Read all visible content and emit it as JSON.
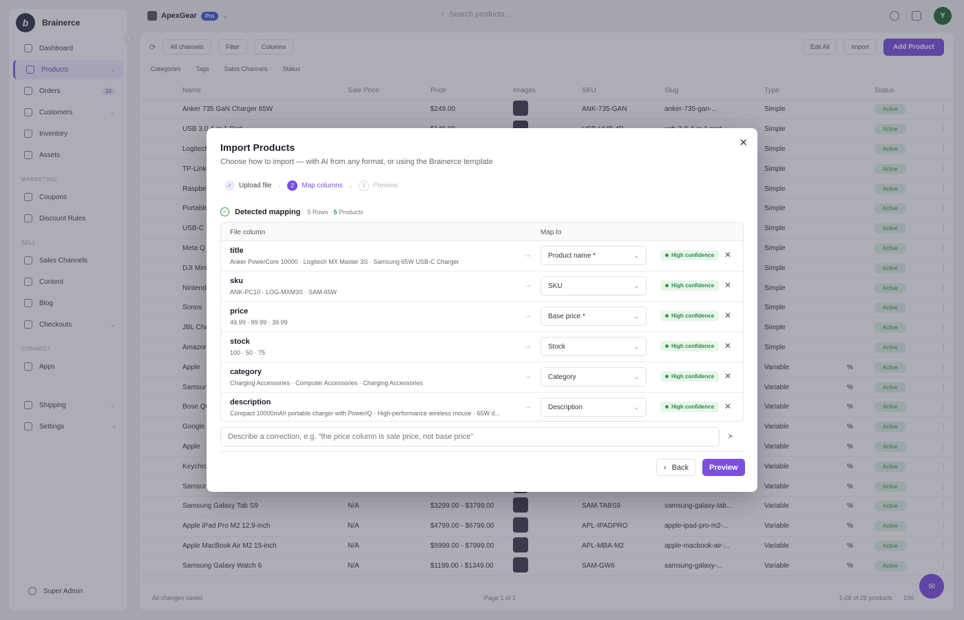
{
  "app": {
    "brand_name": "Brainerce",
    "brand_initial": "b"
  },
  "sidebar": {
    "items": [
      {
        "label": "Dashboard",
        "chevron": "",
        "badge": ""
      },
      {
        "label": "Products",
        "chevron": "⌄",
        "badge": ""
      },
      {
        "label": "Orders",
        "chevron": "",
        "badge": "10"
      },
      {
        "label": "Customers",
        "chevron": "⌄",
        "badge": ""
      },
      {
        "label": "Inventory",
        "chevron": "",
        "badge": ""
      },
      {
        "label": "Assets",
        "chevron": "",
        "badge": ""
      }
    ],
    "section_marketing": "MARKETING",
    "marketing_items": [
      {
        "label": "Coupons"
      },
      {
        "label": "Discount Rules"
      }
    ],
    "section_sell": "SELL",
    "sell_items": [
      {
        "label": "Sales Channels",
        "chevron": ""
      },
      {
        "label": "Content",
        "chevron": ""
      },
      {
        "label": "Blog",
        "chevron": ""
      },
      {
        "label": "Checkouts",
        "chevron": "⌄"
      }
    ],
    "section_connect": "CONNECT",
    "connect_items": [
      {
        "label": "Apps"
      }
    ],
    "bottom_items": [
      {
        "label": "Shipping",
        "chevron": "⌄"
      },
      {
        "label": "Settings",
        "chevron": "›"
      }
    ],
    "footer_label": "Super Admin"
  },
  "topbar": {
    "store_name": "ApexGear",
    "store_badge": "Pro",
    "search_placeholder": "Search products..."
  },
  "toolbar": {
    "all_channels": "All channels",
    "filter": "Filter",
    "columns": "Columns",
    "edit_all": "Edit All",
    "import": "Import",
    "add_product": "Add Product"
  },
  "filters": [
    "Categories",
    "Tags",
    "Sales Channels",
    "Status"
  ],
  "table": {
    "headers": [
      "Name",
      "Sale Price",
      "Price",
      "Images",
      "SKU",
      "Slug",
      "Type",
      "",
      "Status"
    ],
    "rows": [
      {
        "name": "Anker 735 GaN Charger 65W",
        "sale": "",
        "price": "$249.00",
        "sku": "ANK-735-GAN",
        "slug": "anker-735-gan-...",
        "type": "Simple",
        "var": "",
        "status": "Active"
      },
      {
        "name": "USB 3.0 4-in-1 Port",
        "sale": "",
        "price": "$149.00",
        "sku": "USB-HUB-4P",
        "slug": "usb-3-0-4-in-1-port",
        "type": "Simple",
        "var": "",
        "status": "Active"
      },
      {
        "name": "Logitech",
        "sale": "",
        "price": "",
        "sku": "",
        "slug": "",
        "type": "Simple",
        "var": "",
        "status": "Active"
      },
      {
        "name": "TP-Link",
        "sale": "",
        "price": "",
        "sku": "",
        "slug": "",
        "type": "Simple",
        "var": "",
        "status": "Active"
      },
      {
        "name": "Raspberry",
        "sale": "",
        "price": "",
        "sku": "",
        "slug": "",
        "type": "Simple",
        "var": "",
        "status": "Active"
      },
      {
        "name": "Portable",
        "sale": "",
        "price": "",
        "sku": "",
        "slug": "",
        "type": "Simple",
        "var": "",
        "status": "Active"
      },
      {
        "name": "USB-C",
        "sale": "",
        "price": "",
        "sku": "",
        "slug": "",
        "type": "Simple",
        "var": "",
        "status": "Active"
      },
      {
        "name": "Meta Q",
        "sale": "",
        "price": "",
        "sku": "",
        "slug": "",
        "type": "Simple",
        "var": "",
        "status": "Active"
      },
      {
        "name": "DJI Mini",
        "sale": "",
        "price": "",
        "sku": "",
        "slug": "",
        "type": "Simple",
        "var": "",
        "status": "Active"
      },
      {
        "name": "Nintendo",
        "sale": "",
        "price": "",
        "sku": "",
        "slug": "",
        "type": "Simple",
        "var": "",
        "status": "Active"
      },
      {
        "name": "Sonos",
        "sale": "",
        "price": "",
        "sku": "",
        "slug": "",
        "type": "Simple",
        "var": "",
        "status": "Active"
      },
      {
        "name": "JBL Charge",
        "sale": "",
        "price": "",
        "sku": "",
        "slug": "",
        "type": "Simple",
        "var": "",
        "status": "Active"
      },
      {
        "name": "Amazon",
        "sale": "",
        "price": "",
        "sku": "",
        "slug": "",
        "type": "Simple",
        "var": "",
        "status": "Active"
      },
      {
        "name": "Apple",
        "sale": "",
        "price": "",
        "sku": "",
        "slug": "",
        "type": "Variable",
        "var": "%",
        "status": "Active"
      },
      {
        "name": "Samsung",
        "sale": "",
        "price": "",
        "sku": "",
        "slug": "",
        "type": "Variable",
        "var": "%",
        "status": "Active"
      },
      {
        "name": "Bose QC",
        "sale": "",
        "price": "",
        "sku": "",
        "slug": "",
        "type": "Variable",
        "var": "%",
        "status": "Active"
      },
      {
        "name": "Google",
        "sale": "",
        "price": "",
        "sku": "",
        "slug": "",
        "type": "Variable",
        "var": "%",
        "status": "Active"
      },
      {
        "name": "Apple",
        "sale": "",
        "price": "",
        "sku": "",
        "slug": "",
        "type": "Variable",
        "var": "%",
        "status": "Active"
      },
      {
        "name": "Keychron",
        "sale": "",
        "price": "",
        "sku": "",
        "slug": "",
        "type": "Variable",
        "var": "%",
        "status": "Active"
      },
      {
        "name": "Samsung",
        "sale": "",
        "price": "",
        "sku": "",
        "slug": "",
        "type": "Variable",
        "var": "%",
        "status": "Active"
      },
      {
        "name": "Samsung Galaxy Tab S9",
        "sale": "N/A",
        "price": "$3299.00 - $3799.00",
        "sku": "SAM-TABS9",
        "slug": "samsung-galaxy-tab...",
        "type": "Variable",
        "var": "%",
        "status": "Active"
      },
      {
        "name": "Apple iPad Pro M2 12.9-inch",
        "sale": "N/A",
        "price": "$4799.00 - $6799.00",
        "sku": "APL-IPADPRO",
        "slug": "apple-ipad-pro-m2-...",
        "type": "Variable",
        "var": "%",
        "status": "Active"
      },
      {
        "name": "Apple MacBook Air M2 15-inch",
        "sale": "N/A",
        "price": "$5999.00 - $7999.00",
        "sku": "APL-MBA-M2",
        "slug": "apple-macbook-air-...",
        "type": "Variable",
        "var": "%",
        "status": "Active"
      },
      {
        "name": "Samsung Galaxy Watch 6",
        "sale": "N/A",
        "price": "$1199.00 - $1349.00",
        "sku": "SAM-GW6",
        "slug": "samsung-galaxy-...",
        "type": "Variable",
        "var": "%",
        "status": "Active"
      }
    ],
    "footer_saved": "All changes saved",
    "footer_page": "Page 1 of 1",
    "footer_count": "1-28 of 28 products",
    "footer_per_page": "100"
  },
  "modal": {
    "title": "Import Products",
    "subtitle": "Choose how to import — with AI from any format, or using the Brainerce template",
    "steps": [
      {
        "num": "✓",
        "label": "Upload file"
      },
      {
        "num": "2",
        "label": "Map columns"
      },
      {
        "num": "3",
        "label": "Preview"
      }
    ],
    "mapping_title": "Detected mapping",
    "mapping_rows": "5 Rows · ",
    "mapping_products_num": "5",
    "mapping_products_label": " Products",
    "col_header_file": "File column",
    "col_header_map": "Map to",
    "rows": [
      {
        "column": "title",
        "sample": "Anker PowerCore 10000 · Logitech MX Master 3S · Samsung 65W USB-C Charger",
        "map_to": "Product name *",
        "confidence": "High confidence"
      },
      {
        "column": "sku",
        "sample": "ANK-PC10 · LOG-MXM3S · SAM-65W",
        "map_to": "SKU",
        "confidence": "High confidence"
      },
      {
        "column": "price",
        "sample": "49.99 · 99.99 · 39.99",
        "map_to": "Base price *",
        "confidence": "High confidence"
      },
      {
        "column": "stock",
        "sample": "100 · 50 · 75",
        "map_to": "Stock",
        "confidence": "High confidence"
      },
      {
        "column": "category",
        "sample": "Charging Accessories · Computer Accessories · Charging Accessories",
        "map_to": "Category",
        "confidence": "High confidence"
      },
      {
        "column": "description",
        "sample": "Compact 10000mAh portable charger with PowerIQ · High-performance wireless mouse · 65W d...",
        "map_to": "Description",
        "confidence": "High confidence"
      }
    ],
    "correction_placeholder": "Describe a correction, e.g. \"the price column is sale price, not base price\"",
    "back_label": "Back",
    "preview_label": "Preview"
  },
  "colors": {
    "accent": "#7b4fe0",
    "success": "#2e9a47"
  }
}
